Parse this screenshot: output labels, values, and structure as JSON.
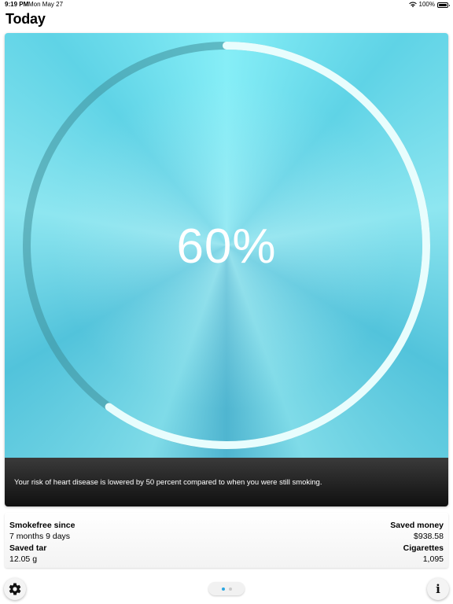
{
  "status_bar": {
    "time": "9:19 PM",
    "date": "Mon May 27",
    "battery": "100%"
  },
  "page": {
    "title": "Today"
  },
  "progress": {
    "label": "60%",
    "fraction": 0.6
  },
  "message": "Your risk of heart disease is lowered by 50 percent compared to when you were still smoking.",
  "stats": {
    "smokefree_since": {
      "label": "Smokefree since",
      "value": "7 months 9 days"
    },
    "saved_money": {
      "label": "Saved money",
      "value": "$938.58"
    },
    "saved_tar": {
      "label": "Saved tar",
      "value": "12.05 g"
    },
    "cigarettes": {
      "label": "Cigarettes",
      "value": "1,095"
    }
  },
  "icons": {
    "settings": "gear-icon",
    "info": "info-icon",
    "info_glyph": "i"
  },
  "pager": {
    "count": 2,
    "active": 0
  },
  "colors": {
    "ring_progress": "#e8fdfd",
    "ring_track": "#3f8f9a",
    "page_dot_active": "#2aa6e0",
    "page_dot_inactive": "#c9c9c9"
  }
}
